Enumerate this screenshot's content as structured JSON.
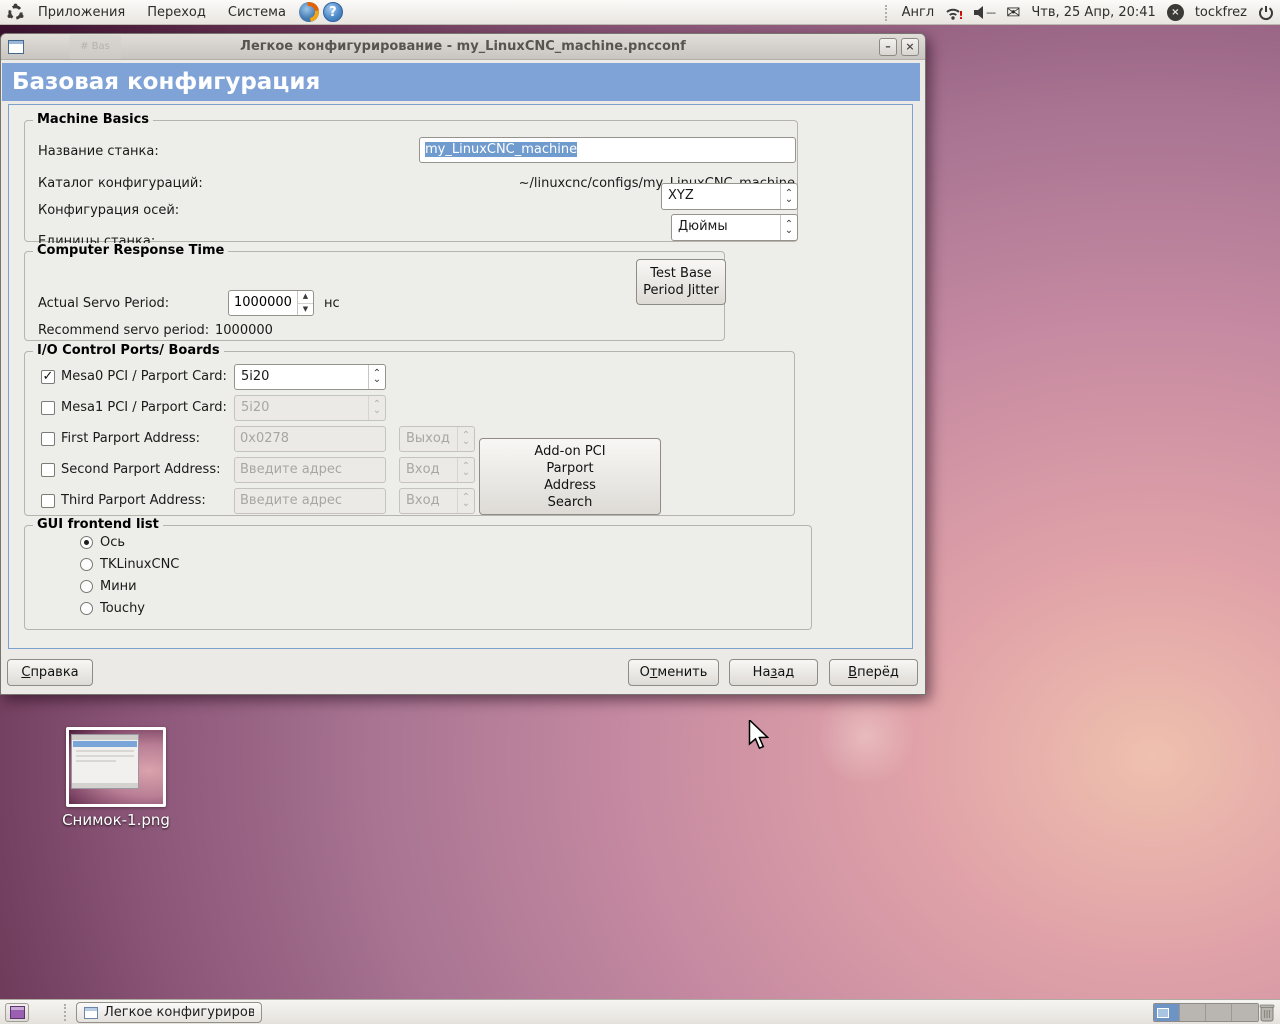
{
  "colors": {
    "header_blue": "#7fa3d6",
    "selection_blue": "#6f9bce",
    "desktop_pink": "#d79aa6",
    "desktop_dark": "#2a081f",
    "active_workspace_blue": "#6d94c4"
  },
  "icons": {
    "check": "✓",
    "chevron_up": "⌃",
    "chevron_down": "⌄",
    "spin_up": "▲",
    "spin_down": "▼",
    "minimize": "–",
    "close": "×",
    "help_question": "?",
    "me_menu": "×",
    "mail_envelope": "✉"
  },
  "top_panel": {
    "menus": [
      {
        "label": "Приложения"
      },
      {
        "label": "Переход"
      },
      {
        "label": "Система"
      }
    ],
    "keyboard_layout": "Англ",
    "wifi_alert": "!",
    "volume_dashes": "---",
    "clock": "Чтв, 25 Апр, 20:41",
    "username": "tockfrez"
  },
  "window": {
    "title": "Легкое конфигурирование - my_LinuxCNC_machine.pncconf",
    "ghost_tab": "# Bas",
    "header_title": "Базовая конфигурация",
    "machine_basics": {
      "legend": "Machine Basics",
      "name_label": "Название станка:",
      "name_value": "my_LinuxCNC_machine",
      "dir_label": "Каталог конфигураций:",
      "dir_value": "~/linuxcnc/configs/my_LinuxCNC_machine",
      "axes_label": "Конфигурация осей:",
      "axes_value": "XYZ",
      "units_label": "Единицы станка:",
      "units_value": "Дюймы"
    },
    "response_time": {
      "legend": "Computer Response Time",
      "servo_label": "Actual Servo Period:",
      "servo_value": "1000000",
      "servo_unit": "нс",
      "recommend_label": "Recommend servo period:",
      "recommend_value": "1000000",
      "test_button": {
        "line1": "Test Base",
        "line2": "Period Jitter"
      }
    },
    "io_ports": {
      "legend": "I/O Control Ports/ Boards",
      "rows": [
        {
          "label": "Mesa0 PCI / Parport Card:",
          "value": "5i20"
        },
        {
          "label": "Mesa1 PCI / Parport Card:",
          "value": "5i20"
        },
        {
          "label": "First Parport Address:",
          "value": "0x0278",
          "direction": "Выход"
        },
        {
          "label": "Second Parport Address:",
          "value": "Введите адрес",
          "direction": "Вход"
        },
        {
          "label": "Third Parport Address:",
          "value": "Введите адрес",
          "direction": "Вход"
        }
      ],
      "search_button": {
        "line1": "Add-on PCI",
        "line2": "Parport",
        "line3": "Address",
        "line4": "Search"
      }
    },
    "gui_list": {
      "legend": "GUI frontend list",
      "options": [
        {
          "label": "Ось"
        },
        {
          "label": "TKLinuxCNC"
        },
        {
          "label": "Мини"
        },
        {
          "label": "Touchy"
        }
      ],
      "selected": "Ось"
    },
    "buttons": {
      "help": {
        "pre": "",
        "accel": "С",
        "rest": "правка"
      },
      "cancel": {
        "pre": "О",
        "accel": "т",
        "rest": "менить"
      },
      "back": {
        "pre": "На",
        "accel": "з",
        "rest": "ад"
      },
      "forward": {
        "pre": "",
        "accel": "В",
        "rest": "перёд"
      }
    }
  },
  "desktop": {
    "icon_label": "Снимок-1.png"
  },
  "taskbar": {
    "task_button": "Легкое конфигурирован..."
  }
}
